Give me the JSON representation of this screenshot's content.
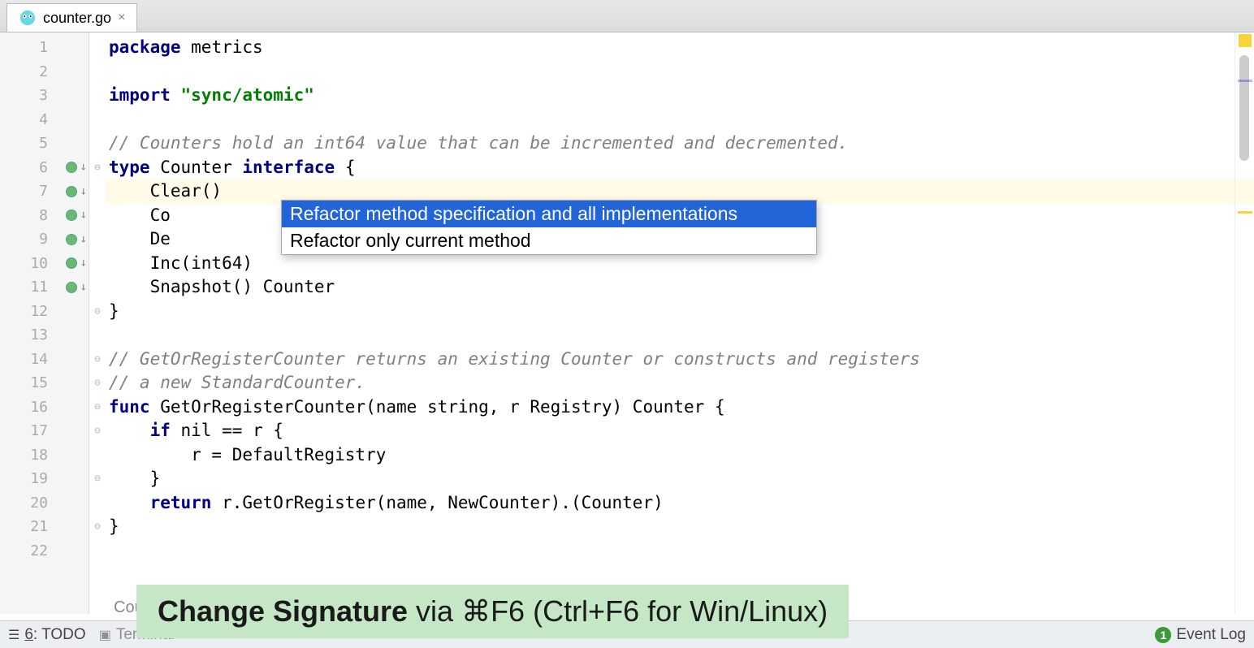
{
  "tab": {
    "filename": "counter.go"
  },
  "gutter": {
    "lines": [
      1,
      2,
      3,
      4,
      5,
      6,
      7,
      8,
      9,
      10,
      11,
      12,
      13,
      14,
      15,
      16,
      17,
      18,
      19,
      20,
      21,
      22
    ],
    "markers": [
      6,
      7,
      8,
      9,
      10,
      11
    ]
  },
  "code": {
    "l1_kw": "package",
    "l1_rest": " metrics",
    "l3_kw": "import",
    "l3_str": " \"sync/atomic\"",
    "l5": "// Counters hold an int64 value that can be incremented and decremented.",
    "l6_a": "type",
    "l6_b": " Counter ",
    "l6_c": "interface",
    "l6_d": " {",
    "l7": "    Clear()",
    "l8": "    Co",
    "l9": "    De",
    "l10": "    Inc(int64)",
    "l11": "    Snapshot() Counter",
    "l12": "}",
    "l14": "// GetOrRegisterCounter returns an existing Counter or constructs and registers",
    "l15": "// a new StandardCounter.",
    "l16_a": "func",
    "l16_b": " GetOrRegisterCounter(name string, r Registry) Counter {",
    "l17_a": "    ",
    "l17_b": "if",
    "l17_c": " nil == r {",
    "l18": "        r = DefaultRegistry",
    "l19": "    }",
    "l20_a": "    ",
    "l20_b": "return",
    "l20_c": " r.GetOrRegister(name, NewCounter).(Counter)",
    "l21": "}"
  },
  "menu": {
    "item1": "Refactor method specification and all implementations",
    "item2": "Refactor only current method"
  },
  "hint": {
    "strong": "Change Signature",
    "rest": " via ⌘F6 (Ctrl+F6 for Win/Linux)"
  },
  "breadcrumb": "Cou",
  "status": {
    "todo_prefix": "6",
    "todo_label": ": TODO",
    "terminal": "Terminal",
    "event_badge": "1",
    "event_log": "Event Log"
  }
}
